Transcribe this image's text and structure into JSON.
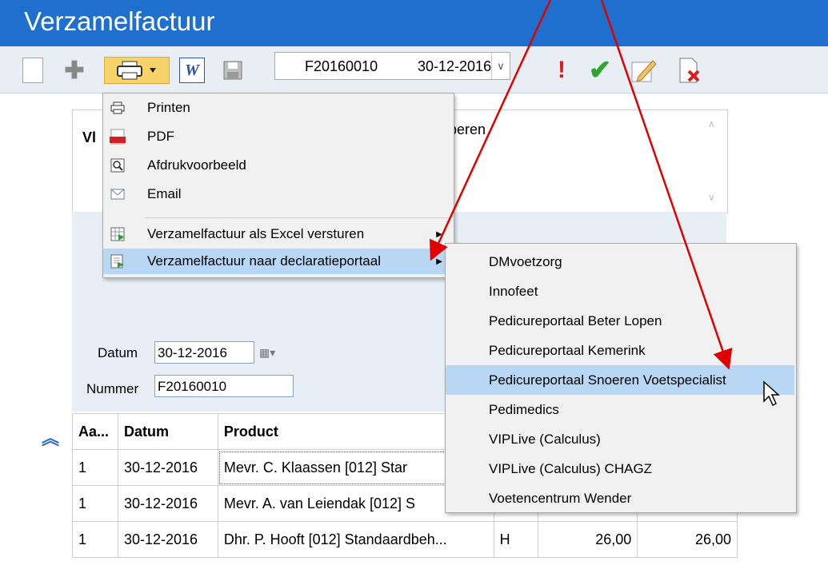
{
  "window": {
    "title": "Verzamelfactuur"
  },
  "toolbar": {
    "combo_number": "F20160010",
    "combo_date": "30-12-2016",
    "word_label": "W"
  },
  "note_panel": {
    "label": "Vl",
    "text": "peren"
  },
  "form": {
    "datum_label": "Datum",
    "datum_value": "30-12-2016",
    "nummer_label": "Nummer",
    "nummer_value": "F20160010"
  },
  "table": {
    "headers": [
      "Aa...",
      "Datum",
      "Product",
      "",
      "",
      ""
    ],
    "rows": [
      [
        "1",
        "30-12-2016",
        "Mevr. C. Klaassen [012] Star",
        "",
        "",
        ""
      ],
      [
        "1",
        "30-12-2016",
        "Mevr. A. van Leiendak [012] S",
        "",
        "",
        ""
      ],
      [
        "1",
        "30-12-2016",
        "Dhr. P. Hooft [012] Standaardbeh...",
        "H",
        "26,00",
        "26,00"
      ]
    ]
  },
  "print_menu": {
    "items": [
      {
        "label": "Printen",
        "icon": "printer-icon"
      },
      {
        "label": "PDF",
        "icon": "pdf-icon"
      },
      {
        "label": "Afdrukvoorbeeld",
        "icon": "magnifier-icon"
      },
      {
        "label": "Email",
        "icon": "envelope-icon"
      },
      {
        "label": "Verzamelfactuur als Excel versturen",
        "icon": "excel-icon"
      },
      {
        "label": "Verzamelfactuur naar declaratieportaal",
        "icon": "portal-icon"
      }
    ]
  },
  "portal_submenu": {
    "items": [
      "DMvoetzorg",
      "Innofeet",
      "Pedicureportaal Beter Lopen",
      "Pedicureportaal Kemerink",
      "Pedicureportaal Snoeren Voetspecialist",
      "Pedimedics",
      "VIPLive (Calculus)",
      "VIPLive (Calculus) CHAGZ",
      "Voetencentrum Wender"
    ],
    "highlighted": "Pedicureportaal Snoeren Voetspecialist"
  },
  "colors": {
    "titlebar": "#1f6fcf",
    "highlight": "#b7d7f5",
    "annotation_arrow": "#e00000"
  }
}
